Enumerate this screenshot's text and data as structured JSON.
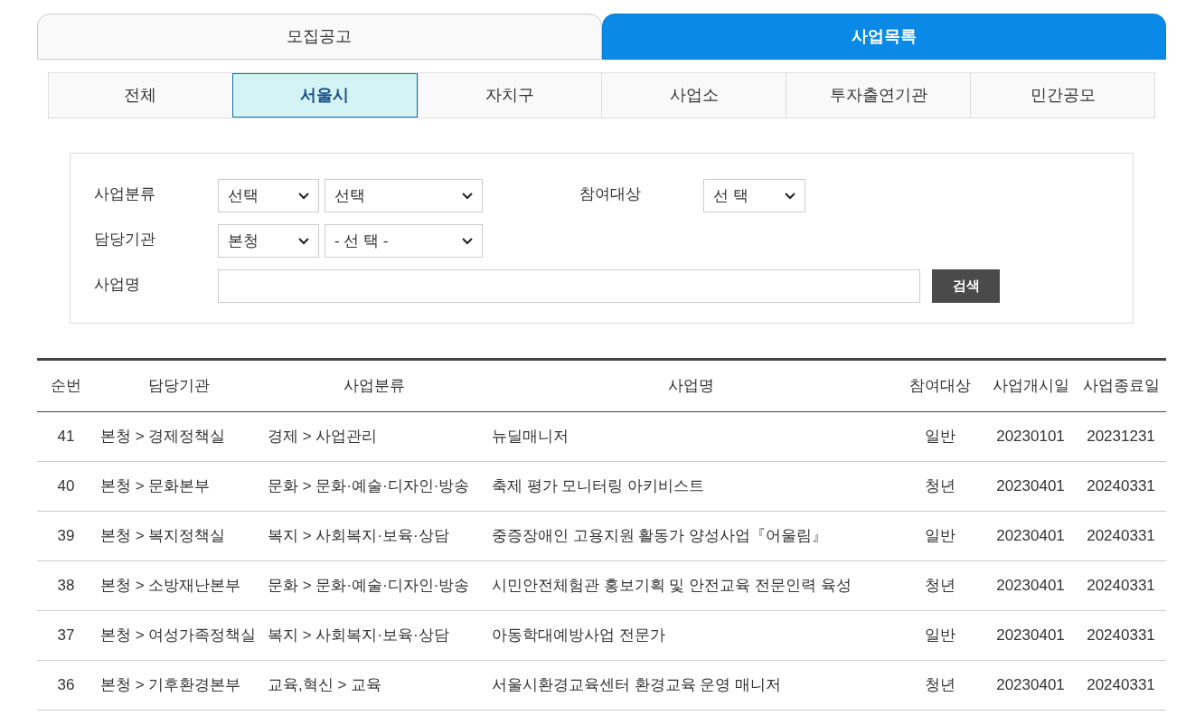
{
  "tabs": [
    {
      "label": "모집공고",
      "selected": false
    },
    {
      "label": "사업목록",
      "selected": true
    }
  ],
  "sub_tabs": [
    {
      "label": "전체",
      "selected": false
    },
    {
      "label": "서울시",
      "selected": true
    },
    {
      "label": "자치구",
      "selected": false
    },
    {
      "label": "사업소",
      "selected": false
    },
    {
      "label": "투자출연기관",
      "selected": false
    },
    {
      "label": "민간공모",
      "selected": false
    }
  ],
  "filters": {
    "category": {
      "label": "사업분류",
      "selects": [
        "선택",
        "선택"
      ]
    },
    "target": {
      "label": "참여대상",
      "selects": [
        "선 택"
      ]
    },
    "agency": {
      "label": "담당기관",
      "selects": [
        "본청",
        "- 선 택 -"
      ]
    },
    "name": {
      "label": "사업명"
    },
    "search_button": "검색"
  },
  "table": {
    "columns": [
      "순번",
      "담당기관",
      "사업분류",
      "사업명",
      "참여대상",
      "사업개시일",
      "사업종료일"
    ],
    "rows": [
      [
        "41",
        "본청 > 경제정책실",
        "경제 > 사업관리",
        "뉴딜매니저",
        "일반",
        "20230101",
        "20231231"
      ],
      [
        "40",
        "본청 > 문화본부",
        "문화 > 문화·예술·디자인·방송",
        "축제 평가 모니터링 아키비스트",
        "청년",
        "20230401",
        "20240331"
      ],
      [
        "39",
        "본청 > 복지정책실",
        "복지 > 사회복지·보육·상담",
        "중증장애인 고용지원 활동가 양성사업『어울림』",
        "일반",
        "20230401",
        "20240331"
      ],
      [
        "38",
        "본청 > 소방재난본부",
        "문화 > 문화·예술·디자인·방송",
        "시민안전체험관 홍보기획 및 안전교육 전문인력 육성",
        "청년",
        "20230401",
        "20240331"
      ],
      [
        "37",
        "본청 > 여성가족정책실",
        "복지 > 사회복지·보육·상담",
        "아동학대예방사업 전문가",
        "일반",
        "20230401",
        "20240331"
      ],
      [
        "36",
        "본청 > 기후환경본부",
        "교육,혁신 > 교육",
        "서울시환경교육센터 환경교육 운영 매니저",
        "청년",
        "20230401",
        "20240331"
      ]
    ]
  }
}
